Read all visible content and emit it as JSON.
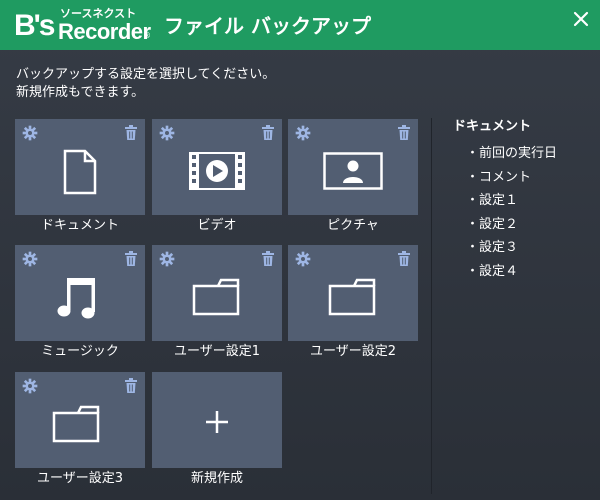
{
  "header": {
    "logo_top": "ソースネクスト",
    "logo_main": "B's",
    "logo_sub": "Recorder",
    "logo_reg": "®",
    "title": "ファイル バックアップ",
    "close_icon": "close-icon"
  },
  "instructions": {
    "line1": "バックアップする設定を選択してください。",
    "line2": "新規作成もできます。"
  },
  "tiles": [
    {
      "label": "ドキュメント",
      "icon": "document-icon"
    },
    {
      "label": "ビデオ",
      "icon": "video-icon"
    },
    {
      "label": "ピクチャ",
      "icon": "picture-icon"
    },
    {
      "label": "ミュージック",
      "icon": "music-icon"
    },
    {
      "label": "ユーザー設定1",
      "icon": "folder-icon"
    },
    {
      "label": "ユーザー設定2",
      "icon": "folder-icon"
    },
    {
      "label": "ユーザー設定3",
      "icon": "folder-icon"
    }
  ],
  "new_tile": {
    "label": "新規作成",
    "icon": "plus-icon"
  },
  "tile_actions": {
    "settings_icon": "gear-icon",
    "delete_icon": "trash-icon"
  },
  "sidebar": {
    "title": "ドキュメント",
    "items": [
      "・前回の実行日",
      "・コメント",
      "・設定１",
      "・設定２",
      "・設定３",
      "・設定４"
    ]
  },
  "colors": {
    "titlebar": "#1f9b61",
    "tile": "#525e72",
    "background": "#2c313a",
    "action_icon": "#9eb6e4"
  }
}
